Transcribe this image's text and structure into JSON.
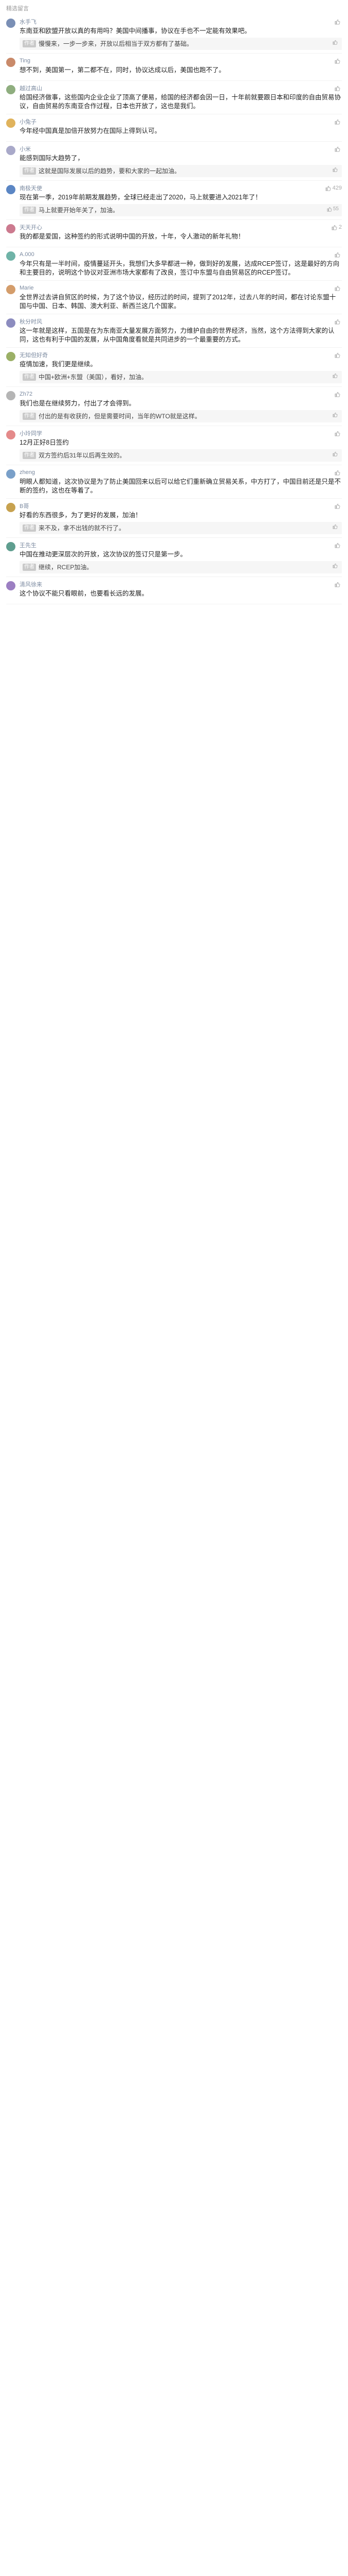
{
  "section_title": "精选留言",
  "comments": [
    {
      "name": "水手飞",
      "likes": "",
      "avatar_color": "#7a8fb5",
      "text": "东南亚和欧盟开放以真的有用吗？美国中间播事，协议在手也不一定能有效果吧。",
      "reply": {
        "author": "作者",
        "text": "慢慢来，一步一步来，开放以后相当于双方都有了基础。",
        "likes": ""
      }
    },
    {
      "name": "Ting",
      "likes": "",
      "avatar_color": "#c98a6a",
      "text": "想不到，美国第一，第二都不在，同时，协议达成以后，美国也跑不了。",
      "reply": null
    },
    {
      "name": "越过高山",
      "likes": "",
      "avatar_color": "#8fae7f",
      "text": "给国经济做事，这些国内企业企业了顶高了便易，给国的经济都会因一日，十年前就要跟日本和印度的自由贸易协议，自由贸易的东南亚合作过程，日本也开放了，这也是我们。",
      "reply": null
    },
    {
      "name": "小兔子",
      "likes": "",
      "avatar_color": "#e0b35c",
      "text": "今年经中国真是加倍开放努力在国际上得到认可。",
      "reply": null
    },
    {
      "name": "小米",
      "likes": "",
      "avatar_color": "#a9a9c9",
      "text": "能感到国际大趋势了，",
      "reply": {
        "author": "作者",
        "text": "这就是国际发展以后的趋势，要和大家的一起加油。",
        "likes": ""
      }
    },
    {
      "name": "南极天使",
      "likes": "429",
      "avatar_color": "#5b86c4",
      "text": "现在第一季，2019年前期发展趋势，全球已经走出了2020，马上就要进入2021年了！",
      "reply": {
        "author": "作者",
        "text": "马上就要开始年关了，加油。",
        "likes": "55"
      }
    },
    {
      "name": "天天开心",
      "likes": "2",
      "avatar_color": "#cc7a8f",
      "text": "我的都是爱国，这种签约的形式说明中国的开放，十年，令人激动的新年礼物！",
      "reply": null
    },
    {
      "name": "A.000",
      "likes": "",
      "avatar_color": "#6fb3a7",
      "text": "今年只有是一半时间，疫情蔓延开头，我想们大多早都进一种，做到好的发展，达成RCEP签订，这是最好的方向和主要目的，说明这个协议对亚洲市场大家都有了改良，签订中东盟与自由贸易区的RCEP签订。",
      "reply": null
    },
    {
      "name": "Marie",
      "likes": "",
      "avatar_color": "#d49d6b",
      "text": "全世界过去讲自贸区的时候，为了这个协议，经历过的时间，提到了2012年，过去八年的时间，都在讨论东盟十国与中国、日本、韩国、澳大利亚、新西兰这几个国家。",
      "reply": null
    },
    {
      "name": "秋分时风",
      "likes": "",
      "avatar_color": "#8c8cbf",
      "text": "这一年就是这样，五国是在为东南亚大量发展方面努力，力维护自由的世界经济，当然，这个方法得到大家的认同，这也有利于中国的发展，从中国角度看就是共同进步的一个最重要的方式。",
      "reply": null
    },
    {
      "name": "无知但好奇",
      "likes": "",
      "avatar_color": "#9bb066",
      "text": "疫情加速，我们更是继续。",
      "reply": {
        "author": "作者",
        "text": "中国+欧洲+东盟（美国），看好，加油。",
        "likes": ""
      }
    },
    {
      "name": "Zh72",
      "likes": "",
      "avatar_color": "#b5b5b5",
      "text": "我们也是在继续努力，付出了才会得到。",
      "reply": {
        "author": "作者",
        "text": "付出的是有收获的，但是需要时间，当年的WTO就是这样。",
        "likes": ""
      }
    },
    {
      "name": "小玲同学",
      "likes": "",
      "avatar_color": "#e48a8a",
      "text": "12月正好8日签约",
      "reply": {
        "author": "作者",
        "text": "双方签约后31年以后再生效的。",
        "likes": ""
      }
    },
    {
      "name": "zheng",
      "likes": "",
      "avatar_color": "#7aa0c9",
      "text": "明眼人都知道，这次协议是为了防止美国回来以后可以给它们重新确立贸易关系，中方打了，中国目前还是只是不断的签约，这也在等着了。",
      "reply": null
    },
    {
      "name": "B哥",
      "likes": "",
      "avatar_color": "#c7a24f",
      "text": "好看的东西很多，为了更好的发展，加油！",
      "reply": {
        "author": "作者",
        "text": "来不及，拿不出钱的就不行了。",
        "likes": ""
      }
    },
    {
      "name": "王先生",
      "likes": "",
      "avatar_color": "#5f9e8f",
      "text": "中国在推动更深层次的开放，这次协议的签订只是第一步。",
      "reply": {
        "author": "作者",
        "text": "继续，RCEP加油。",
        "likes": ""
      }
    },
    {
      "name": "清风徐来",
      "likes": "",
      "avatar_color": "#9c7fc2",
      "text": "这个协议不能只看眼前，也要看长远的发展。",
      "reply": null
    }
  ]
}
